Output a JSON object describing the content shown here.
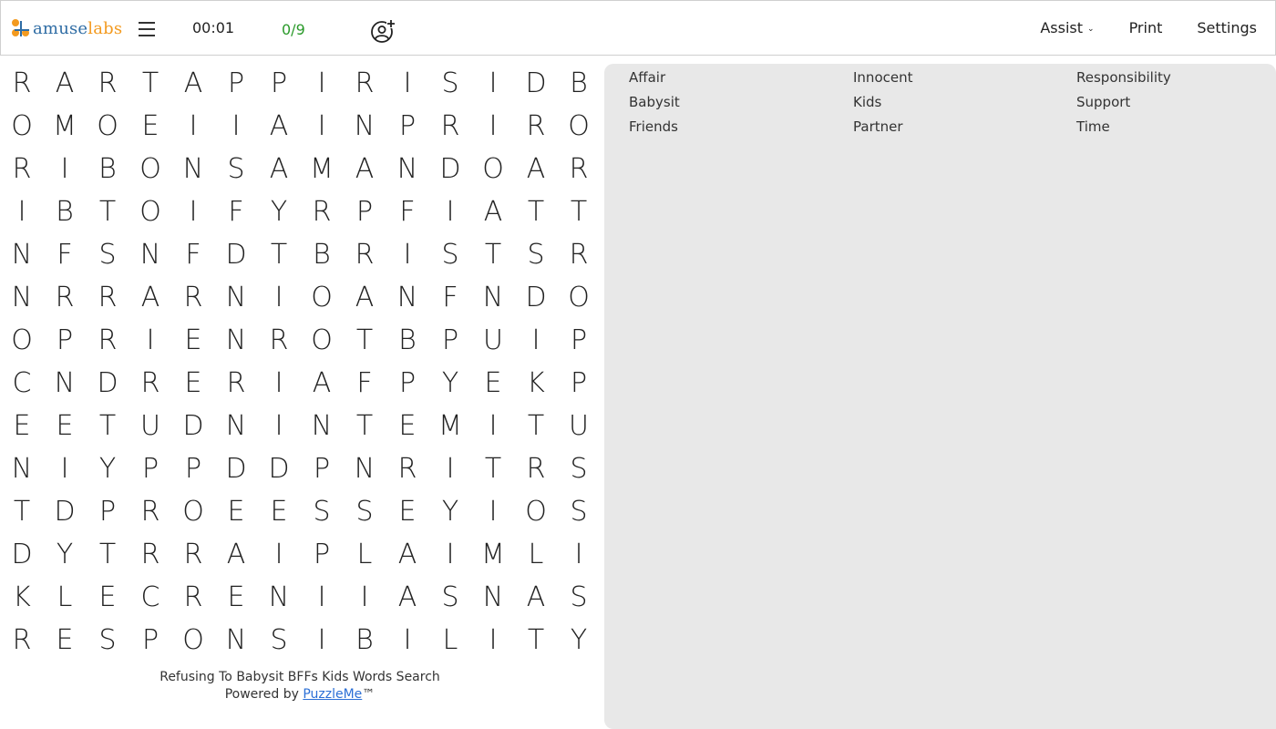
{
  "header": {
    "logo_part1": "amuse",
    "logo_part2": "labs",
    "timer": "00:01",
    "progress": "0/9",
    "nav": [
      {
        "label": "Assist",
        "has_dropdown": true
      },
      {
        "label": "Print",
        "has_dropdown": false
      },
      {
        "label": "Settings",
        "has_dropdown": false
      }
    ],
    "icons": {
      "menu": "hamburger-icon",
      "add_user": "add-user-icon",
      "dropdown": "chevron-down-icon"
    }
  },
  "colors": {
    "logo_blue": "#2e6ca4",
    "logo_orange": "#f39a1f",
    "progress_green": "#2a9a2a",
    "panel_bg": "#e8e8e8",
    "link_blue": "#2b6fd6"
  },
  "grid": [
    [
      "R",
      "A",
      "R",
      "T",
      "A",
      "P",
      "P",
      "I",
      "R",
      "I",
      "S",
      "I",
      "D",
      "B"
    ],
    [
      "O",
      "M",
      "O",
      "E",
      "I",
      "I",
      "A",
      "I",
      "N",
      "P",
      "R",
      "I",
      "R",
      "O"
    ],
    [
      "R",
      "I",
      "B",
      "O",
      "N",
      "S",
      "A",
      "M",
      "A",
      "N",
      "D",
      "O",
      "A",
      "R"
    ],
    [
      "I",
      "B",
      "T",
      "O",
      "I",
      "F",
      "Y",
      "R",
      "P",
      "F",
      "I",
      "A",
      "T",
      "T"
    ],
    [
      "N",
      "F",
      "S",
      "N",
      "F",
      "D",
      "T",
      "B",
      "R",
      "I",
      "S",
      "T",
      "S",
      "R"
    ],
    [
      "N",
      "R",
      "R",
      "A",
      "R",
      "N",
      "I",
      "O",
      "A",
      "N",
      "F",
      "N",
      "D",
      "O"
    ],
    [
      "O",
      "P",
      "R",
      "I",
      "E",
      "N",
      "R",
      "O",
      "T",
      "B",
      "P",
      "U",
      "I",
      "P"
    ],
    [
      "C",
      "N",
      "D",
      "R",
      "E",
      "R",
      "I",
      "A",
      "F",
      "P",
      "Y",
      "E",
      "K",
      "P"
    ],
    [
      "E",
      "E",
      "T",
      "U",
      "D",
      "N",
      "I",
      "N",
      "T",
      "E",
      "M",
      "I",
      "T",
      "U"
    ],
    [
      "N",
      "I",
      "Y",
      "P",
      "P",
      "D",
      "D",
      "P",
      "N",
      "R",
      "I",
      "T",
      "R",
      "S"
    ],
    [
      "T",
      "D",
      "P",
      "R",
      "O",
      "E",
      "E",
      "S",
      "S",
      "E",
      "Y",
      "I",
      "O",
      "S"
    ],
    [
      "D",
      "Y",
      "T",
      "R",
      "R",
      "A",
      "I",
      "P",
      "L",
      "A",
      "I",
      "M",
      "L",
      "I"
    ],
    [
      "K",
      "L",
      "E",
      "C",
      "R",
      "E",
      "N",
      "I",
      "I",
      "A",
      "S",
      "N",
      "A",
      "S"
    ],
    [
      "R",
      "E",
      "S",
      "P",
      "O",
      "N",
      "S",
      "I",
      "B",
      "I",
      "L",
      "I",
      "T",
      "Y"
    ]
  ],
  "footer": {
    "title": "Refusing To Babysit BFFs Kids Words Search",
    "powered_prefix": "Powered by ",
    "powered_link": "PuzzleMe",
    "trademark": "™"
  },
  "words": [
    [
      "Affair",
      "Babysit",
      "Friends"
    ],
    [
      "Innocent",
      "Kids",
      "Partner"
    ],
    [
      "Responsibility",
      "Support",
      "Time"
    ]
  ]
}
